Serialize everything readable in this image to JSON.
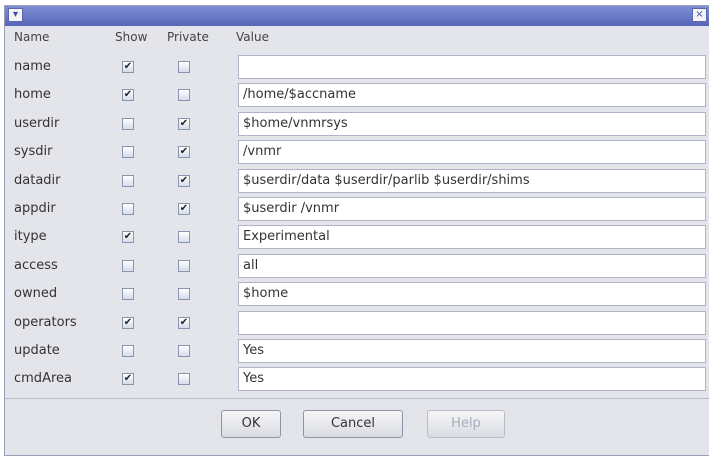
{
  "dialog": {
    "menu_icon": "chevron-down-icon",
    "close_glyph": "×"
  },
  "columns": {
    "name": "Name",
    "show": "Show",
    "private": "Private",
    "value": "Value"
  },
  "rows": [
    {
      "name": "name",
      "show": true,
      "private": false,
      "value": ""
    },
    {
      "name": "home",
      "show": true,
      "private": false,
      "value": "/home/$accname"
    },
    {
      "name": "userdir",
      "show": false,
      "private": true,
      "value": "$home/vnmrsys"
    },
    {
      "name": "sysdir",
      "show": false,
      "private": true,
      "value": "/vnmr"
    },
    {
      "name": "datadir",
      "show": false,
      "private": true,
      "value": "$userdir/data $userdir/parlib $userdir/shims"
    },
    {
      "name": "appdir",
      "show": false,
      "private": true,
      "value": "$userdir /vnmr"
    },
    {
      "name": "itype",
      "show": true,
      "private": false,
      "value": "Experimental"
    },
    {
      "name": "access",
      "show": false,
      "private": false,
      "value": "all"
    },
    {
      "name": "owned",
      "show": false,
      "private": false,
      "value": "$home"
    },
    {
      "name": "operators",
      "show": true,
      "private": true,
      "value": ""
    },
    {
      "name": "update",
      "show": false,
      "private": false,
      "value": "Yes"
    },
    {
      "name": "cmdArea",
      "show": true,
      "private": false,
      "value": "Yes"
    }
  ],
  "buttons": {
    "ok": "OK",
    "cancel": "Cancel",
    "help": "Help"
  }
}
